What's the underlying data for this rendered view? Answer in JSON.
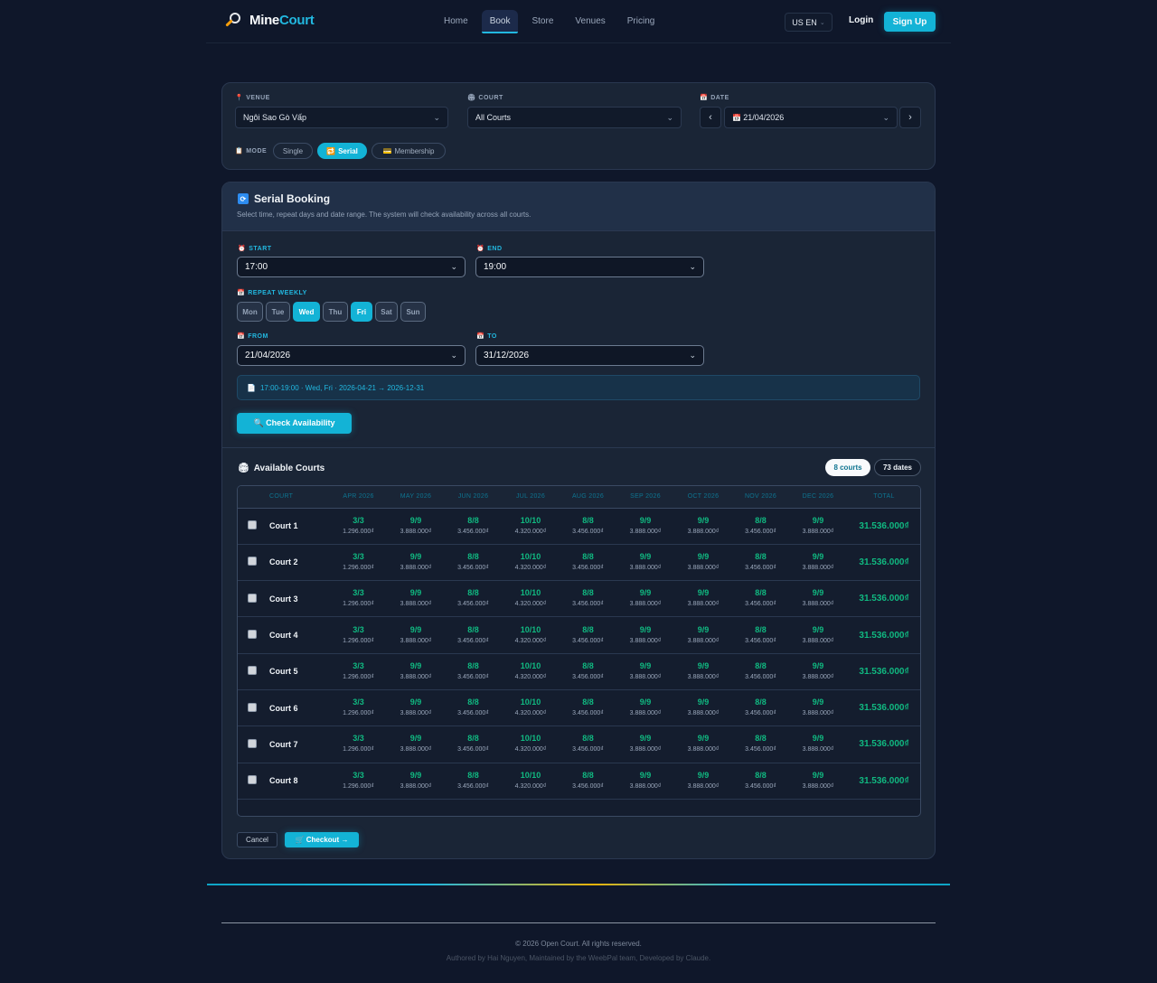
{
  "brand": {
    "name_part1": "Mine",
    "name_part2": "Court",
    "logo_icon": "badminton-racket-icon"
  },
  "nav": {
    "items": [
      {
        "label": "Home",
        "active": false
      },
      {
        "label": "Book",
        "active": true
      },
      {
        "label": "Store",
        "active": false
      },
      {
        "label": "Venues",
        "active": false
      },
      {
        "label": "Pricing",
        "active": false
      }
    ],
    "language": "US EN",
    "login": "Login",
    "signup": "Sign Up"
  },
  "filters": {
    "venue_label": "VENUE",
    "venue_value": "Ngôi Sao Gò Vấp",
    "court_label": "COURT",
    "court_value": "All Courts",
    "date_label": "DATE",
    "date_value": "21/04/2026",
    "prev": "‹",
    "next": "›",
    "mode_label": "MODE",
    "modes": [
      "Single",
      "Serial",
      "Membership"
    ],
    "active_mode": "Serial"
  },
  "serial": {
    "title": "Serial Booking",
    "subtitle": "Select time, repeat days and date range. The system will check availability across all courts.",
    "start_label": "START",
    "start_value": "17:00",
    "end_label": "END",
    "end_value": "19:00",
    "repeat_label": "REPEAT WEEKLY",
    "days": [
      {
        "label": "Mon",
        "on": false
      },
      {
        "label": "Tue",
        "on": false
      },
      {
        "label": "Wed",
        "on": true
      },
      {
        "label": "Thu",
        "on": false
      },
      {
        "label": "Fri",
        "on": true
      },
      {
        "label": "Sat",
        "on": false
      },
      {
        "label": "Sun",
        "on": false
      }
    ],
    "from_label": "FROM",
    "from_value": "21/04/2026",
    "to_label": "TO",
    "to_value": "31/12/2026",
    "summary": "17:00-19:00 · Wed, Fri · 2026-04-21 → 2026-12-31",
    "check_button": "Check Availability"
  },
  "available": {
    "title": "Available Courts",
    "courts_badge": "8 courts",
    "dates_badge": "73 dates",
    "columns": [
      "COURT",
      "APR 2026",
      "MAY 2026",
      "JUN 2026",
      "JUL 2026",
      "AUG 2026",
      "SEP 2026",
      "OCT 2026",
      "NOV 2026",
      "DEC 2026",
      "TOTAL"
    ],
    "rows": [
      {
        "court": "Court 1",
        "cells": [
          [
            "3/3",
            "1.296.000₫"
          ],
          [
            "9/9",
            "3.888.000₫"
          ],
          [
            "8/8",
            "3.456.000₫"
          ],
          [
            "10/10",
            "4.320.000₫"
          ],
          [
            "8/8",
            "3.456.000₫"
          ],
          [
            "9/9",
            "3.888.000₫"
          ],
          [
            "9/9",
            "3.888.000₫"
          ],
          [
            "8/8",
            "3.456.000₫"
          ],
          [
            "9/9",
            "3.888.000₫"
          ]
        ],
        "total": "31.536.000₫"
      },
      {
        "court": "Court 2",
        "cells": [
          [
            "3/3",
            "1.296.000₫"
          ],
          [
            "9/9",
            "3.888.000₫"
          ],
          [
            "8/8",
            "3.456.000₫"
          ],
          [
            "10/10",
            "4.320.000₫"
          ],
          [
            "8/8",
            "3.456.000₫"
          ],
          [
            "9/9",
            "3.888.000₫"
          ],
          [
            "9/9",
            "3.888.000₫"
          ],
          [
            "8/8",
            "3.456.000₫"
          ],
          [
            "9/9",
            "3.888.000₫"
          ]
        ],
        "total": "31.536.000₫"
      },
      {
        "court": "Court 3",
        "cells": [
          [
            "3/3",
            "1.296.000₫"
          ],
          [
            "9/9",
            "3.888.000₫"
          ],
          [
            "8/8",
            "3.456.000₫"
          ],
          [
            "10/10",
            "4.320.000₫"
          ],
          [
            "8/8",
            "3.456.000₫"
          ],
          [
            "9/9",
            "3.888.000₫"
          ],
          [
            "9/9",
            "3.888.000₫"
          ],
          [
            "8/8",
            "3.456.000₫"
          ],
          [
            "9/9",
            "3.888.000₫"
          ]
        ],
        "total": "31.536.000₫"
      },
      {
        "court": "Court 4",
        "cells": [
          [
            "3/3",
            "1.296.000₫"
          ],
          [
            "9/9",
            "3.888.000₫"
          ],
          [
            "8/8",
            "3.456.000₫"
          ],
          [
            "10/10",
            "4.320.000₫"
          ],
          [
            "8/8",
            "3.456.000₫"
          ],
          [
            "9/9",
            "3.888.000₫"
          ],
          [
            "9/9",
            "3.888.000₫"
          ],
          [
            "8/8",
            "3.456.000₫"
          ],
          [
            "9/9",
            "3.888.000₫"
          ]
        ],
        "total": "31.536.000₫"
      },
      {
        "court": "Court 5",
        "cells": [
          [
            "3/3",
            "1.296.000₫"
          ],
          [
            "9/9",
            "3.888.000₫"
          ],
          [
            "8/8",
            "3.456.000₫"
          ],
          [
            "10/10",
            "4.320.000₫"
          ],
          [
            "8/8",
            "3.456.000₫"
          ],
          [
            "9/9",
            "3.888.000₫"
          ],
          [
            "9/9",
            "3.888.000₫"
          ],
          [
            "8/8",
            "3.456.000₫"
          ],
          [
            "9/9",
            "3.888.000₫"
          ]
        ],
        "total": "31.536.000₫"
      },
      {
        "court": "Court 6",
        "cells": [
          [
            "3/3",
            "1.296.000₫"
          ],
          [
            "9/9",
            "3.888.000₫"
          ],
          [
            "8/8",
            "3.456.000₫"
          ],
          [
            "10/10",
            "4.320.000₫"
          ],
          [
            "8/8",
            "3.456.000₫"
          ],
          [
            "9/9",
            "3.888.000₫"
          ],
          [
            "9/9",
            "3.888.000₫"
          ],
          [
            "8/8",
            "3.456.000₫"
          ],
          [
            "9/9",
            "3.888.000₫"
          ]
        ],
        "total": "31.536.000₫"
      },
      {
        "court": "Court 7",
        "cells": [
          [
            "3/3",
            "1.296.000₫"
          ],
          [
            "9/9",
            "3.888.000₫"
          ],
          [
            "8/8",
            "3.456.000₫"
          ],
          [
            "10/10",
            "4.320.000₫"
          ],
          [
            "8/8",
            "3.456.000₫"
          ],
          [
            "9/9",
            "3.888.000₫"
          ],
          [
            "9/9",
            "3.888.000₫"
          ],
          [
            "8/8",
            "3.456.000₫"
          ],
          [
            "9/9",
            "3.888.000₫"
          ]
        ],
        "total": "31.536.000₫"
      },
      {
        "court": "Court 8",
        "cells": [
          [
            "3/3",
            "1.296.000₫"
          ],
          [
            "9/9",
            "3.888.000₫"
          ],
          [
            "8/8",
            "3.456.000₫"
          ],
          [
            "10/10",
            "4.320.000₫"
          ],
          [
            "8/8",
            "3.456.000₫"
          ],
          [
            "9/9",
            "3.888.000₫"
          ],
          [
            "9/9",
            "3.888.000₫"
          ],
          [
            "8/8",
            "3.456.000₫"
          ],
          [
            "9/9",
            "3.888.000₫"
          ]
        ],
        "total": "31.536.000₫"
      }
    ]
  },
  "actions": {
    "cancel": "Cancel",
    "checkout": "Checkout →"
  },
  "footer": {
    "copyright": "© 2026 Open Court. All rights reserved.",
    "credits": "Authored by Hai Nguyen, Maintained by the WeebPal team, Developed by Claude."
  },
  "colors": {
    "accent": "#13b3d6",
    "available_green": "#10b981",
    "background": "#0f172a"
  }
}
